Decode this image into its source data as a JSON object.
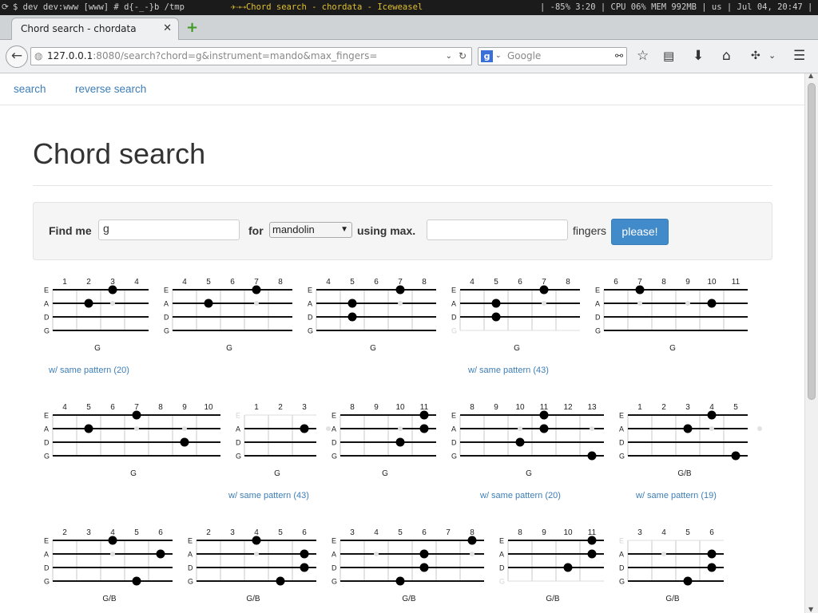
{
  "sysbar": {
    "left": "$ dev dev:www [www] # d{-_-}b /tmp",
    "title": "✈⇢⇢Chord search - chordata - Iceweasel",
    "right": "| -85% 3:20 | CPU 06% MEM 992MB | us | Jul 04, 20:47 |"
  },
  "browser": {
    "tab_title": "Chord search - chordata",
    "url_host": "127.0.0.1",
    "url_rest": ":8080/search?chord=g&instrument=mando&max_fingers=",
    "search_placeholder": "Google"
  },
  "nav": {
    "search": "search",
    "reverse_search": "reverse search"
  },
  "page": {
    "title": "Chord search"
  },
  "form": {
    "find_label": "Find me",
    "chord_value": "g",
    "for_label": "for",
    "instrument": "mandolin",
    "using_label": "using max.",
    "fingers_value": "",
    "fingers_label": "fingers",
    "submit": "please!"
  },
  "strings": [
    "E",
    "A",
    "D",
    "G"
  ],
  "diagrams": [
    {
      "frets": [
        "1",
        "2",
        "3",
        "4"
      ],
      "name": "G",
      "dots": [
        [
          0,
          2
        ],
        [
          1,
          1
        ]
      ],
      "ghost": [
        [
          1,
          2
        ]
      ],
      "muted": [],
      "pattern": "w/ same pattern (20)"
    },
    {
      "frets": [
        "4",
        "5",
        "6",
        "7",
        "8"
      ],
      "name": "G",
      "dots": [
        [
          0,
          3
        ],
        [
          1,
          1
        ]
      ],
      "ghost": [
        [
          1,
          3
        ]
      ],
      "muted": [],
      "pattern": ""
    },
    {
      "frets": [
        "4",
        "5",
        "6",
        "7",
        "8"
      ],
      "name": "G",
      "dots": [
        [
          0,
          3
        ],
        [
          1,
          1
        ],
        [
          2,
          1
        ]
      ],
      "ghost": [
        [
          1,
          3
        ]
      ],
      "muted": [],
      "pattern": ""
    },
    {
      "frets": [
        "4",
        "5",
        "6",
        "7",
        "8"
      ],
      "name": "G",
      "dots": [
        [
          0,
          3
        ],
        [
          1,
          1
        ],
        [
          2,
          1
        ]
      ],
      "ghost": [
        [
          1,
          3
        ]
      ],
      "muted": [
        3
      ],
      "pattern": "w/ same pattern (43)"
    },
    {
      "frets": [
        "6",
        "7",
        "8",
        "9",
        "10",
        "11"
      ],
      "name": "G",
      "dots": [
        [
          0,
          1
        ],
        [
          1,
          4
        ]
      ],
      "ghost": [
        [
          1,
          1
        ],
        [
          1,
          3
        ]
      ],
      "muted": [],
      "pattern": ""
    },
    {
      "frets": [
        "4",
        "5",
        "6",
        "7",
        "8",
        "9",
        "10"
      ],
      "name": "G",
      "dots": [
        [
          0,
          3
        ],
        [
          1,
          1
        ],
        [
          2,
          5
        ]
      ],
      "ghost": [
        [
          1,
          3
        ],
        [
          1,
          5
        ]
      ],
      "muted": [],
      "pattern": ""
    },
    {
      "frets": [
        "1",
        "2",
        "3"
      ],
      "name": "G",
      "dots": [
        [
          1,
          2
        ]
      ],
      "ghost": [
        [
          1,
          3
        ]
      ],
      "muted": [
        0
      ],
      "pattern": "w/ same pattern (43)"
    },
    {
      "frets": [
        "8",
        "9",
        "10",
        "11"
      ],
      "name": "G",
      "dots": [
        [
          0,
          3
        ],
        [
          1,
          3
        ],
        [
          2,
          2
        ]
      ],
      "ghost": [
        [
          1,
          2
        ]
      ],
      "muted": [],
      "pattern": ""
    },
    {
      "frets": [
        "8",
        "9",
        "10",
        "11",
        "12",
        "13"
      ],
      "name": "G",
      "dots": [
        [
          0,
          3
        ],
        [
          1,
          3
        ],
        [
          2,
          2
        ],
        [
          3,
          5
        ]
      ],
      "ghost": [
        [
          1,
          2
        ],
        [
          1,
          5
        ]
      ],
      "muted": [],
      "pattern": "w/ same pattern (20)"
    },
    {
      "frets": [
        "1",
        "2",
        "3",
        "4",
        "5"
      ],
      "name": "G/B",
      "dots": [
        [
          0,
          3
        ],
        [
          1,
          2
        ],
        [
          3,
          4
        ]
      ],
      "ghost": [
        [
          1,
          3
        ],
        [
          1,
          5
        ]
      ],
      "muted": [],
      "pattern": "w/ same pattern (19)"
    },
    {
      "frets": [
        "2",
        "3",
        "4",
        "5",
        "6"
      ],
      "name": "G/B",
      "dots": [
        [
          0,
          2
        ],
        [
          1,
          4
        ],
        [
          3,
          3
        ]
      ],
      "ghost": [
        [
          1,
          2
        ],
        [
          1,
          4
        ]
      ],
      "muted": [],
      "pattern": ""
    },
    {
      "frets": [
        "2",
        "3",
        "4",
        "5",
        "6"
      ],
      "name": "G/B",
      "dots": [
        [
          0,
          2
        ],
        [
          1,
          4
        ],
        [
          2,
          4
        ],
        [
          3,
          3
        ]
      ],
      "ghost": [
        [
          1,
          2
        ]
      ],
      "muted": [],
      "pattern": ""
    },
    {
      "frets": [
        "3",
        "4",
        "5",
        "6",
        "7",
        "8"
      ],
      "name": "G/B",
      "dots": [
        [
          0,
          5
        ],
        [
          1,
          3
        ],
        [
          2,
          3
        ],
        [
          3,
          2
        ]
      ],
      "ghost": [
        [
          1,
          1
        ],
        [
          1,
          5
        ]
      ],
      "muted": [],
      "pattern": ""
    },
    {
      "frets": [
        "8",
        "9",
        "10",
        "11"
      ],
      "name": "G/B",
      "dots": [
        [
          0,
          3
        ],
        [
          1,
          3
        ],
        [
          2,
          2
        ]
      ],
      "ghost": [],
      "muted": [
        3
      ],
      "pattern": ""
    },
    {
      "frets": [
        "3",
        "4",
        "5",
        "6"
      ],
      "name": "G/B",
      "dots": [
        [
          1,
          3
        ],
        [
          2,
          3
        ],
        [
          3,
          2
        ]
      ],
      "ghost": [
        [
          1,
          1
        ]
      ],
      "muted": [
        0
      ],
      "pattern": ""
    }
  ]
}
